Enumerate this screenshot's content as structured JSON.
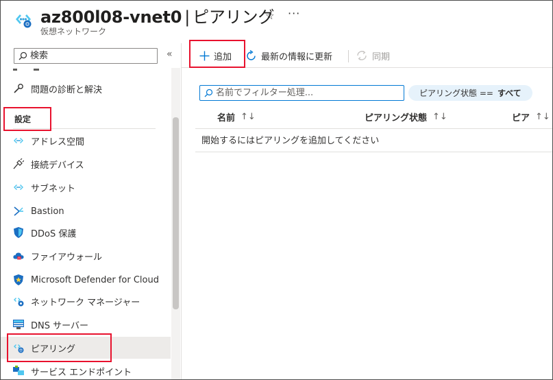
{
  "header": {
    "resource_name": "az800l08-vnet0",
    "separator": "|",
    "blade_name": "ピアリング",
    "resource_type": "仮想ネットワーク",
    "favorite_glyph": "☆",
    "more_glyph": "···"
  },
  "sidebar": {
    "search_placeholder": "検索",
    "collapse_glyph": "«",
    "items_top": [
      {
        "label": "問題の診断と解決",
        "icon": "wrench-icon"
      }
    ],
    "section_title": "設定",
    "items": [
      {
        "label": "アドレス空間",
        "icon": "vnet-icon"
      },
      {
        "label": "接続デバイス",
        "icon": "plug-icon"
      },
      {
        "label": "サブネット",
        "icon": "vnet-icon"
      },
      {
        "label": "Bastion",
        "icon": "bastion-icon"
      },
      {
        "label": "DDoS 保護",
        "icon": "shield-icon"
      },
      {
        "label": "ファイアウォール",
        "icon": "firewall-icon"
      },
      {
        "label": "Microsoft Defender for Cloud",
        "icon": "defender-icon"
      },
      {
        "label": "ネットワーク マネージャー",
        "icon": "network-manager-icon"
      },
      {
        "label": "DNS サーバー",
        "icon": "dns-icon"
      },
      {
        "label": "ピアリング",
        "icon": "peering-icon",
        "selected": true
      },
      {
        "label": "サービス エンドポイント",
        "icon": "service-endpoint-icon"
      }
    ]
  },
  "toolbar": {
    "add_label": "追加",
    "refresh_label": "最新の情報に更新",
    "sync_label": "同期"
  },
  "main": {
    "filter_placeholder": "名前でフィルター処理...",
    "status_filter_label": "ピアリング状態 ==",
    "status_filter_value": "すべて",
    "columns": [
      "名前",
      "ピアリング状態",
      "ピア"
    ],
    "sort_glyph": "↑↓",
    "empty_message": "開始するにはピアリングを追加してください"
  },
  "colors": {
    "accent": "#0078d4",
    "highlight": "#e8112d",
    "selected_bg": "#edebe9"
  }
}
